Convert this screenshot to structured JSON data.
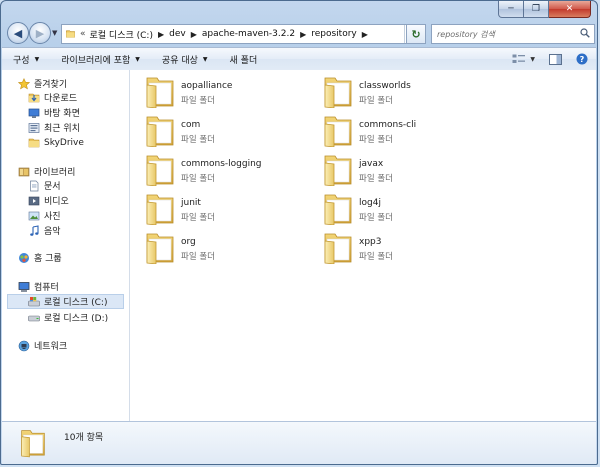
{
  "caption": {
    "minimize_glyph": "─",
    "maximize_glyph": "❐",
    "close_glyph": "✕"
  },
  "nav": {
    "back_glyph": "◀",
    "forward_glyph": "▶",
    "overflow": "«",
    "breadcrumbs": [
      "로컬 디스크 (C:)",
      "dev",
      "apache-maven-3.2.2",
      "repository"
    ],
    "search_placeholder": "repository 검색"
  },
  "toolbar": {
    "organize": "구성",
    "include_library": "라이브러리에 포함",
    "share_with": "공유 대상",
    "new_folder": "새 폴더"
  },
  "sidebar": {
    "favorites": {
      "label": "즐겨찾기",
      "items": [
        "다운로드",
        "바탕 화면",
        "최근 위치",
        "SkyDrive"
      ]
    },
    "libraries": {
      "label": "라이브러리",
      "items": [
        "문서",
        "비디오",
        "사진",
        "음악"
      ]
    },
    "homegroup": {
      "label": "홈 그룹"
    },
    "computer": {
      "label": "컴퓨터",
      "items": [
        "로컬 디스크 (C:)",
        "로컬 디스크 (D:)"
      ],
      "selected": "로컬 디스크 (C:)"
    },
    "network": {
      "label": "네트워크"
    }
  },
  "files": [
    {
      "name": "aopalliance",
      "type": "파일 폴더"
    },
    {
      "name": "classworlds",
      "type": "파일 폴더"
    },
    {
      "name": "com",
      "type": "파일 폴더"
    },
    {
      "name": "commons-cli",
      "type": "파일 폴더"
    },
    {
      "name": "commons-logging",
      "type": "파일 폴더"
    },
    {
      "name": "javax",
      "type": "파일 폴더"
    },
    {
      "name": "junit",
      "type": "파일 폴더"
    },
    {
      "name": "log4j",
      "type": "파일 폴더"
    },
    {
      "name": "org",
      "type": "파일 폴더"
    },
    {
      "name": "xpp3",
      "type": "파일 폴더"
    }
  ],
  "status": {
    "item_count": "10개 항목"
  },
  "icons": {
    "folder": "folder-icon",
    "star": "favorites-star-icon",
    "library": "library-icon",
    "homegroup": "homegroup-icon",
    "computer": "computer-icon",
    "drive": "drive-icon",
    "network": "network-icon"
  },
  "colors": {
    "folder_light": "#f8e49a",
    "folder_dark": "#d9ad3a",
    "selection": "#dbe7f6",
    "window_frame": "#b4cde8"
  }
}
